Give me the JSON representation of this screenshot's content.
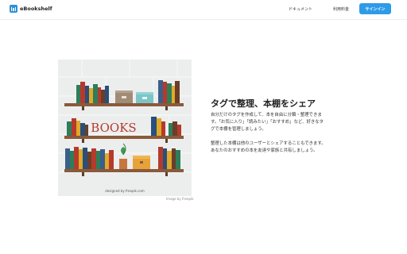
{
  "header": {
    "brand": "eBookshelf",
    "nav": {
      "docs": "ドキュメント",
      "pricing": "利用料金"
    },
    "signin_label": "サインイン"
  },
  "hero": {
    "title": "タグで整理、本棚をシェア",
    "paragraph1": [
      "自分だけのタグを作成して、本を自由に分類・整理できま",
      "す。「お気に入り」「読みたい」「おすすめ」など、好きなタ",
      "グで本棚を管理しましょう。"
    ],
    "paragraph2": [
      "整理した本棚は他のユーザーとシェアすることもできます。",
      "あなたのおすすめの本を友達や家族と共有しましょう。"
    ],
    "illustration_sign": "BOOKS",
    "illustration_credit": "designed by  freepik.com",
    "image_credit": "Image by Freepik"
  },
  "colors": {
    "accent": "#2e9be8",
    "brand_icon": "#2e8fd6",
    "shelf": "#8a5a3b",
    "books_red": "#b53a2c"
  },
  "icons": [
    "bookshelf-logo-icon"
  ]
}
